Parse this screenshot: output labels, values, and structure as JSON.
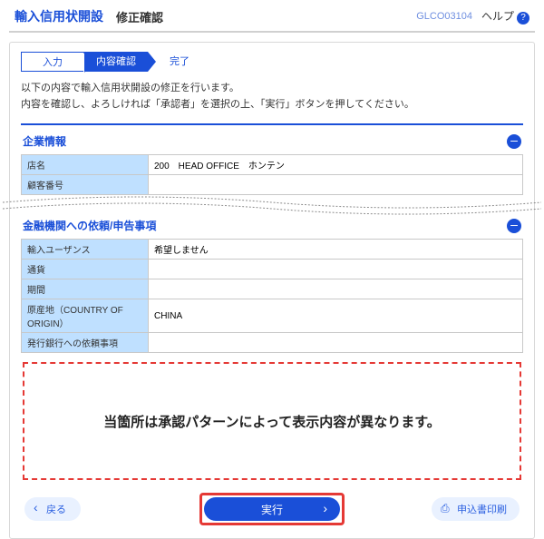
{
  "header": {
    "title": "輸入信用状開設",
    "subtitle": "修正確認",
    "code": "GLCO03104",
    "help": "ヘルプ"
  },
  "steps": {
    "s1": "入力",
    "s2": "内容確認",
    "s3": "完了"
  },
  "intro": {
    "l1": "以下の内容で輸入信用状開設の修正を行います。",
    "l2": "内容を確認し、よろしければ「承認者」を選択の上、「実行」ボタンを押してください。"
  },
  "sec1": {
    "title": "企業情報",
    "rows": {
      "r1": {
        "label": "店名",
        "value": "200　HEAD OFFICE　ホンテン"
      },
      "r2": {
        "label": "顧客番号",
        "value": ""
      }
    }
  },
  "sec2": {
    "title": "金融機関への依頼/申告事項",
    "rows": {
      "r1": {
        "label": "輸入ユーザンス",
        "value": "希望しません"
      },
      "r2": {
        "label": "通貨",
        "value": ""
      },
      "r3": {
        "label": "期間",
        "value": ""
      },
      "r4": {
        "label": "原産地（COUNTRY OF ORIGIN）",
        "value": "CHINA"
      },
      "r5": {
        "label": "発行銀行への依頼事項",
        "value": ""
      }
    }
  },
  "notice": "当箇所は承認パターンによって表示内容が異なります。",
  "buttons": {
    "back": "戻る",
    "exec": "実行",
    "print": "申込書印刷"
  }
}
